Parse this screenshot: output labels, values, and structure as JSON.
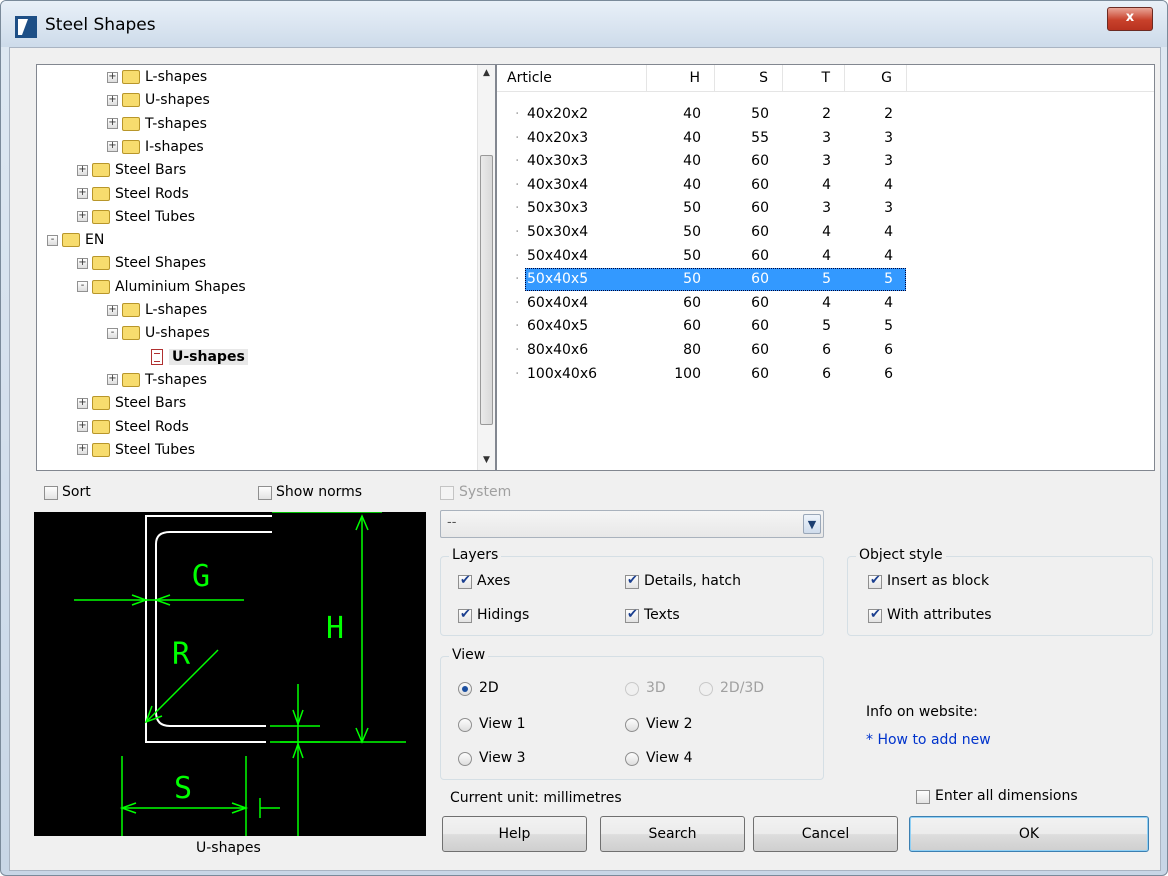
{
  "window": {
    "title": "Steel Shapes",
    "close_glyph": "x"
  },
  "tree": {
    "items": [
      {
        "label": "L-shapes",
        "indent": 2,
        "kind": "folder",
        "expander": "+"
      },
      {
        "label": "U-shapes",
        "indent": 2,
        "kind": "folder",
        "expander": "+"
      },
      {
        "label": "T-shapes",
        "indent": 2,
        "kind": "folder",
        "expander": "+"
      },
      {
        "label": "I-shapes",
        "indent": 2,
        "kind": "folder",
        "expander": "+"
      },
      {
        "label": "Steel Bars",
        "indent": 1,
        "kind": "folder",
        "expander": "+"
      },
      {
        "label": "Steel Rods",
        "indent": 1,
        "kind": "folder",
        "expander": "+"
      },
      {
        "label": "Steel Tubes",
        "indent": 1,
        "kind": "folder",
        "expander": "+"
      },
      {
        "label": "EN",
        "indent": 0,
        "kind": "folder",
        "expander": "-"
      },
      {
        "label": "Steel Shapes",
        "indent": 1,
        "kind": "folder",
        "expander": "+"
      },
      {
        "label": "Aluminium Shapes",
        "indent": 1,
        "kind": "folder",
        "expander": "-"
      },
      {
        "label": "L-shapes",
        "indent": 2,
        "kind": "folder",
        "expander": "+"
      },
      {
        "label": "U-shapes",
        "indent": 2,
        "kind": "folder",
        "expander": "-"
      },
      {
        "label": "U-shapes",
        "indent": 3,
        "kind": "doc",
        "expander": "",
        "selected": true
      },
      {
        "label": "T-shapes",
        "indent": 2,
        "kind": "folder",
        "expander": "+"
      },
      {
        "label": "Steel Bars",
        "indent": 1,
        "kind": "folder",
        "expander": "+"
      },
      {
        "label": "Steel Rods",
        "indent": 1,
        "kind": "folder",
        "expander": "+"
      },
      {
        "label": "Steel Tubes",
        "indent": 1,
        "kind": "folder",
        "expander": "+"
      }
    ]
  },
  "table": {
    "columns": [
      "Article",
      "H",
      "S",
      "T",
      "G"
    ],
    "rows": [
      [
        "40x20x2",
        "40",
        "50",
        "2",
        "2"
      ],
      [
        "40x20x3",
        "40",
        "55",
        "3",
        "3"
      ],
      [
        "40x30x3",
        "40",
        "60",
        "3",
        "3"
      ],
      [
        "40x30x4",
        "40",
        "60",
        "4",
        "4"
      ],
      [
        "50x30x3",
        "50",
        "60",
        "3",
        "3"
      ],
      [
        "50x30x4",
        "50",
        "60",
        "4",
        "4"
      ],
      [
        "50x40x4",
        "50",
        "60",
        "4",
        "4"
      ],
      [
        "50x40x5",
        "50",
        "60",
        "5",
        "5"
      ],
      [
        "60x40x4",
        "60",
        "60",
        "4",
        "4"
      ],
      [
        "60x40x5",
        "60",
        "60",
        "5",
        "5"
      ],
      [
        "80x40x6",
        "80",
        "60",
        "6",
        "6"
      ],
      [
        "100x40x6",
        "100",
        "60",
        "6",
        "6"
      ]
    ],
    "selected_row": 7
  },
  "options": {
    "sort_label": "Sort",
    "sort_checked": false,
    "show_norms_label": "Show norms",
    "show_norms_checked": false,
    "system_label": "System",
    "system_checked": false,
    "system_value": "--"
  },
  "layers": {
    "title": "Layers",
    "axes": {
      "label": "Axes",
      "checked": true
    },
    "details": {
      "label": "Details, hatch",
      "checked": true
    },
    "hidings": {
      "label": "Hidings",
      "checked": true
    },
    "texts": {
      "label": "Texts",
      "checked": true
    }
  },
  "object_style": {
    "title": "Object style",
    "insert_block": {
      "label": "Insert as block",
      "checked": true
    },
    "attributes": {
      "label": "With attributes",
      "checked": true
    }
  },
  "view": {
    "title": "View",
    "options": [
      "2D",
      "3D",
      "2D/3D",
      "View 1",
      "View 2",
      "View 3",
      "View 4"
    ],
    "selected": "2D"
  },
  "info": {
    "label": "Info on website:",
    "link": "* How to add new"
  },
  "unit_text": "Current unit: millimetres",
  "enter_all": {
    "label": "Enter all dimensions",
    "checked": false
  },
  "preview": {
    "caption": "U-shapes",
    "dim_labels": [
      "G",
      "R",
      "H",
      "S"
    ],
    "line_color": "#00ff00"
  },
  "buttons": {
    "help": "Help",
    "search": "Search",
    "cancel": "Cancel",
    "ok": "OK"
  }
}
